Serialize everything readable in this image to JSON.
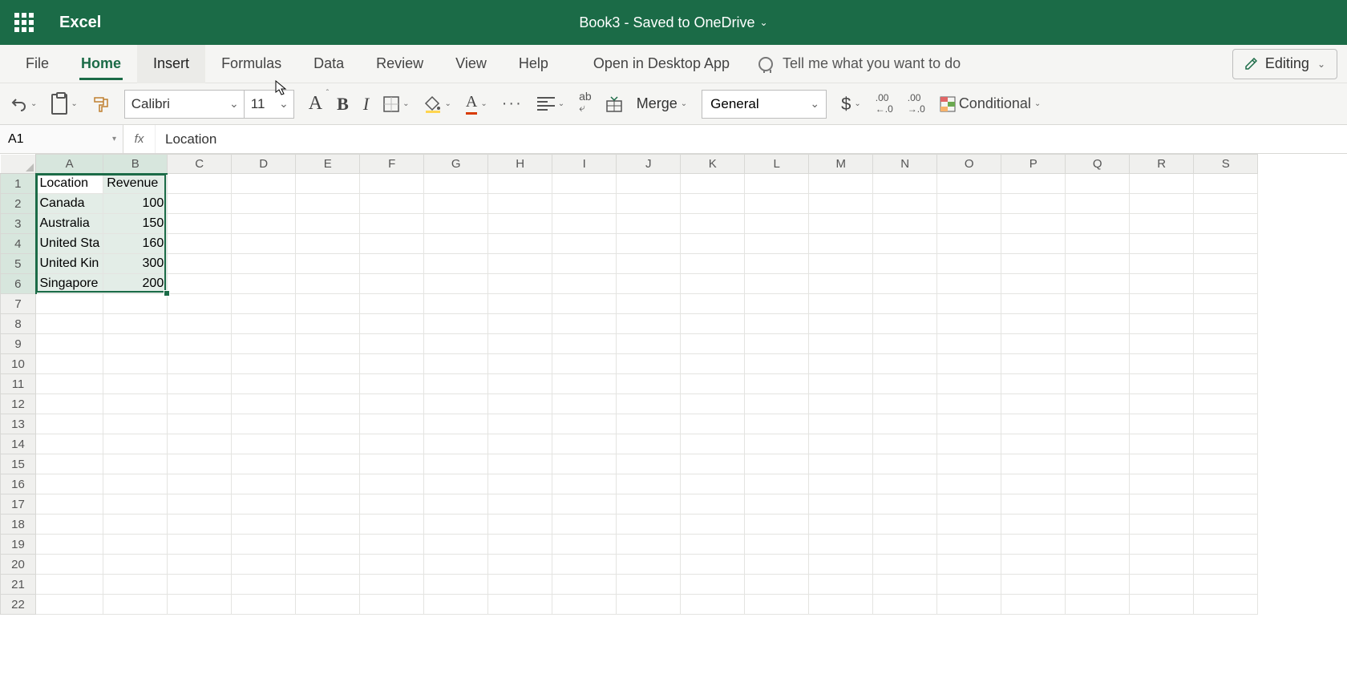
{
  "title_bar": {
    "app_name": "Excel",
    "doc_title": "Book3 - Saved to OneDrive"
  },
  "tabs": {
    "file": "File",
    "home": "Home",
    "insert": "Insert",
    "formulas": "Formulas",
    "data": "Data",
    "review": "Review",
    "view": "View",
    "help": "Help",
    "open_desktop": "Open in Desktop App",
    "tell_me": "Tell me what you want to do",
    "editing": "Editing"
  },
  "ribbon": {
    "font_name": "Calibri",
    "font_size": "11",
    "merge": "Merge",
    "num_format": "General",
    "conditional": "Conditional"
  },
  "formula_bar": {
    "name_box": "A1",
    "fx": "fx",
    "value": "Location"
  },
  "columns": [
    "A",
    "B",
    "C",
    "D",
    "E",
    "F",
    "G",
    "H",
    "I",
    "J",
    "K",
    "L",
    "M",
    "N",
    "O",
    "P",
    "Q",
    "R",
    "S"
  ],
  "col_widths": {
    "A": 80,
    "B": 80,
    "default": 80
  },
  "row_count": 22,
  "selected_cols": [
    "A",
    "B"
  ],
  "selected_rows": [
    1,
    2,
    3,
    4,
    5,
    6
  ],
  "chart_data": {
    "type": "table",
    "headers": [
      "Location",
      "Revenue"
    ],
    "rows": [
      [
        "Canada",
        100
      ],
      [
        "Australia",
        150
      ],
      [
        "United Sta",
        160
      ],
      [
        "United Kin",
        300
      ],
      [
        "Singapore",
        200
      ]
    ]
  },
  "cells": {
    "A1": "Location",
    "B1": "Revenue",
    "A2": "Canada",
    "B2": "100",
    "A3": "Australia",
    "B3": "150",
    "A4": "United Sta",
    "B4": "160",
    "A5": "United Kin",
    "B5": "300",
    "A6": "Singapore",
    "B6": "200"
  }
}
